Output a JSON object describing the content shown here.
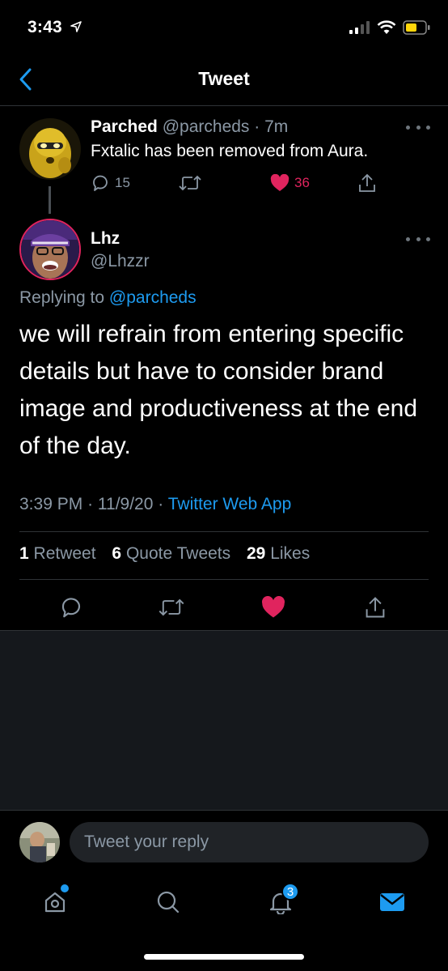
{
  "status_bar": {
    "time": "3:43",
    "icons": [
      "location-arrow-icon",
      "signal-icon",
      "wifi-icon",
      "battery-icon"
    ]
  },
  "nav": {
    "title": "Tweet",
    "back_icon": "chevron-left-icon"
  },
  "parent_tweet": {
    "name": "Parched",
    "handle": "@parcheds",
    "separator": "·",
    "time": "7m",
    "text": "Fxtalic has been removed from Aura.",
    "reply_count": "15",
    "like_count": "36",
    "liked": true
  },
  "main_tweet": {
    "name": "Lhz",
    "handle": "@Lhzzr",
    "replying_prefix": "Replying to",
    "replying_to": "@parcheds",
    "text": "we will refrain from entering specific details but have to consider brand image and productiveness at the end of the day.",
    "time": "3:39 PM",
    "sep1": "·",
    "date": "11/9/20",
    "sep2": "·",
    "source": "Twitter Web App",
    "stats": {
      "retweets_count": "1",
      "retweets_label": "Retweet",
      "quotes_count": "6",
      "quotes_label": "Quote Tweets",
      "likes_count": "29",
      "likes_label": "Likes"
    },
    "liked": true
  },
  "reply_composer": {
    "placeholder": "Tweet your reply"
  },
  "tab_bar": {
    "items": [
      "home-icon",
      "search-icon",
      "notifications-icon",
      "messages-icon"
    ],
    "notifications_badge": "3",
    "home_has_dot": true
  },
  "colors": {
    "accent": "#1d9bf0",
    "like": "#e0245e",
    "background": "#000000",
    "muted": "#8b98a5"
  }
}
